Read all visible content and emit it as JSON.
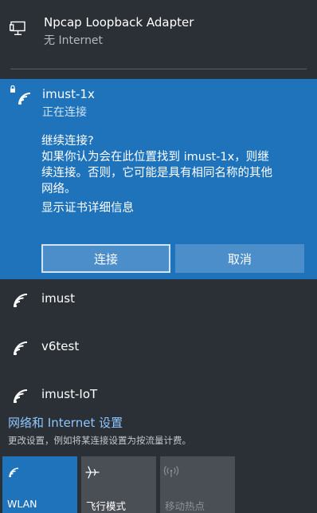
{
  "adapter": {
    "name": "Npcap Loopback Adapter",
    "status": "无 Internet"
  },
  "active_network": {
    "ssid": "imust-1x",
    "state": "正在连接",
    "question": "继续连接?",
    "message_lines": [
      "如果你认为会在此位置找到 imust-1x，则继",
      "续连接。否则，它可能是具有相同名称的其他",
      "网络。"
    ],
    "details_link": "显示证书详细信息",
    "connect_label": "连接",
    "cancel_label": "取消"
  },
  "networks": [
    {
      "ssid": "imust",
      "icon": "wifi-icon"
    },
    {
      "ssid": "v6test",
      "icon": "wifi-icon"
    },
    {
      "ssid": "imust-IoT",
      "icon": "wifi-icon"
    }
  ],
  "settings": {
    "link": "网络和 Internet 设置",
    "description": "更改设置，例如将某连接设置为按流量计费。"
  },
  "quick_actions": [
    {
      "label": "WLAN",
      "icon": "wifi-icon",
      "state": "on"
    },
    {
      "label": "飞行模式",
      "icon": "airplane-icon",
      "state": "off"
    },
    {
      "label": "移动热点",
      "icon": "hotspot-icon",
      "state": "disabled"
    }
  ],
  "colors": {
    "panel_bg": "#2b2f36",
    "accent": "#1f73bb",
    "button_bg": "#4b8ec9",
    "link": "#8dc7ff",
    "tile_bg": "#4a4e55"
  }
}
